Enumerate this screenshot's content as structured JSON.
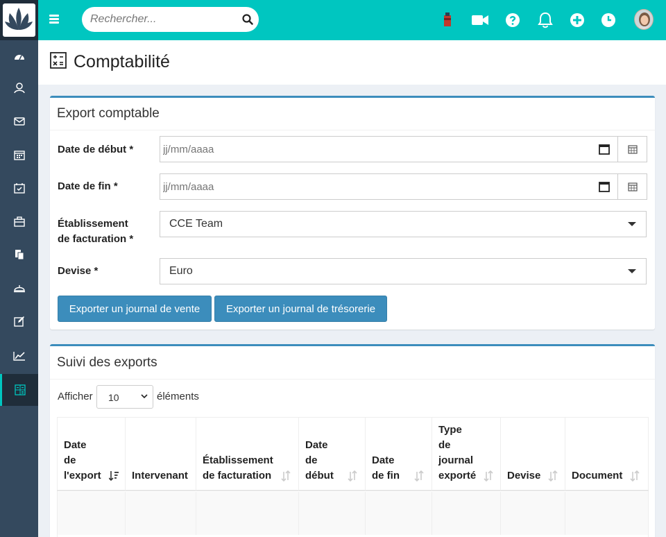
{
  "search": {
    "placeholder": "Rechercher..."
  },
  "page": {
    "title": "Comptabilité"
  },
  "export_card": {
    "title": "Export comptable",
    "fields": {
      "start_label": "Date de début *",
      "end_label": "Date de fin *",
      "etab_label_1": "Établissement",
      "etab_label_2": "de facturation *",
      "devise_label": "Devise *",
      "date_placeholder": "jj/mm/aaaa",
      "etab_value": "CCE Team",
      "devise_value": "Euro"
    },
    "buttons": {
      "sales": "Exporter un journal de vente",
      "treasury": "Exporter un journal de trésorerie"
    }
  },
  "exports_card": {
    "title": "Suivi des exports",
    "length_prefix": "Afficher",
    "length_value": "10",
    "length_suffix": "éléments",
    "columns": [
      [
        "Date",
        "de",
        "l'export"
      ],
      [
        "Intervenant"
      ],
      [
        "Établissement",
        "de facturation"
      ],
      [
        "Date",
        "de",
        "début"
      ],
      [
        "Date",
        "de fin"
      ],
      [
        "Type",
        "de",
        "journal",
        "exporté"
      ],
      [
        "Devise"
      ],
      [
        "Document"
      ]
    ]
  },
  "sidebar": {
    "items": [
      "dashboard-icon",
      "contacts-icon",
      "mail-icon",
      "calendar-icon",
      "tasks-icon",
      "briefcase-icon",
      "documents-icon",
      "services-icon",
      "edit-icon",
      "stats-icon",
      "accounting-icon"
    ]
  },
  "colors": {
    "topbar": "#00c6c0",
    "sidebar": "#34495e",
    "primary": "#3c8dbc"
  }
}
